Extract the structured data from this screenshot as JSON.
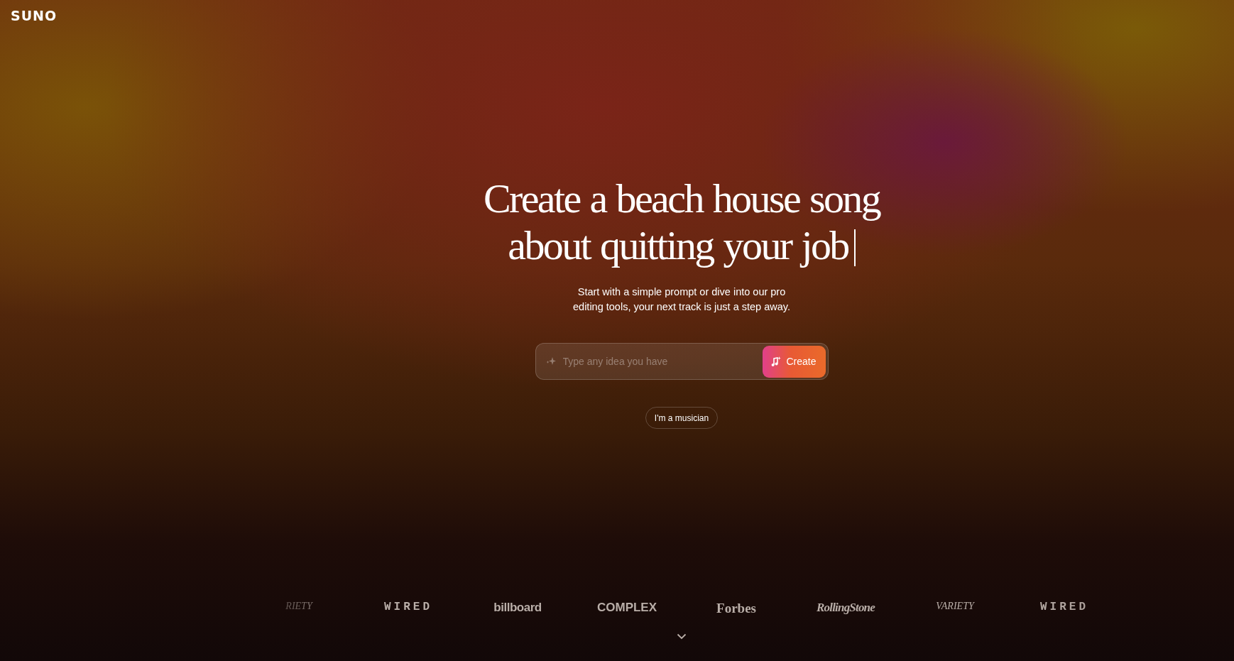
{
  "logo": "SUNO",
  "headline": "Create a beach house song about quitting your job",
  "subtitle": "Start with a simple prompt or dive into our pro editing tools, your next track is just a step away.",
  "prompt": {
    "placeholder": "Type any idea you have",
    "button": "Create"
  },
  "musician_button": "I'm a musician",
  "press_logos": [
    {
      "text": "RIETY",
      "kind": "variety"
    },
    {
      "text": "WIRED",
      "kind": "wired"
    },
    {
      "text": "billboard",
      "kind": "billboard"
    },
    {
      "text": "COMPLEX",
      "kind": "complex"
    },
    {
      "text": "Forbes",
      "kind": "forbes"
    },
    {
      "text": "RollingStone",
      "kind": "rollingstone"
    },
    {
      "text": "VARIETY",
      "kind": "variety"
    },
    {
      "text": "WIRED",
      "kind": "wired"
    }
  ]
}
